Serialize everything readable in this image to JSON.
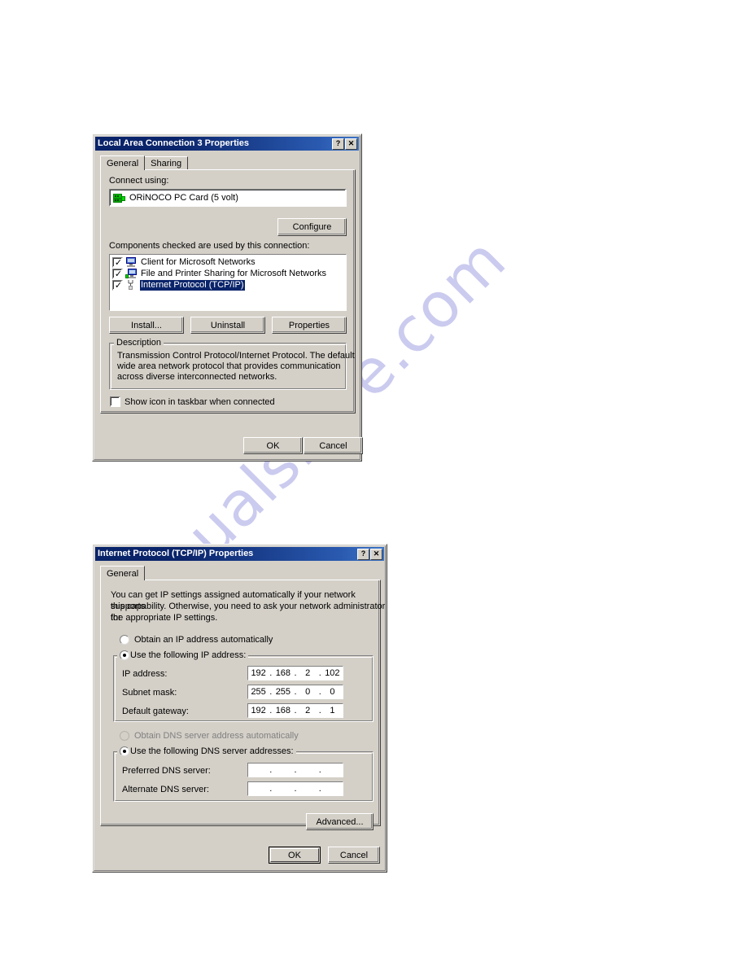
{
  "page": {
    "background": "#ffffff",
    "watermark_text": "manualshive.com",
    "watermark_color": "#c9c9ef"
  },
  "theme": {
    "dialog_face": "#d4d0c8",
    "titlebar_start": "#0a246a",
    "titlebar_end": "#3b74c6",
    "selection_blue": "#0a246a",
    "disabled_text": "#808080"
  },
  "dialog1": {
    "title": "Local Area Connection 3 Properties",
    "titlebar_buttons": [
      {
        "name": "help-icon",
        "glyph": "?"
      },
      {
        "name": "close-icon",
        "glyph": "✕"
      }
    ],
    "tabs": [
      {
        "label": "General",
        "active": true
      },
      {
        "label": "Sharing",
        "active": false
      }
    ],
    "connect_using_label": "Connect using:",
    "adapter": {
      "name": "ORiNOCO PC Card (5 volt)",
      "icon": "network-card-icon"
    },
    "configure_button": "Configure",
    "components_label": "Components checked are used by this connection:",
    "components": [
      {
        "label": "Client for Microsoft Networks",
        "checked": true,
        "selected": false,
        "icon": "computer-icon"
      },
      {
        "label": "File and Printer Sharing for Microsoft Networks",
        "checked": true,
        "selected": false,
        "icon": "sharing-computer-icon"
      },
      {
        "label": "Internet Protocol (TCP/IP)",
        "checked": true,
        "selected": true,
        "icon": "protocol-icon"
      }
    ],
    "buttons": {
      "install": "Install...",
      "uninstall": "Uninstall",
      "properties": "Properties"
    },
    "description": {
      "group_title": "Description",
      "line1": "Transmission Control Protocol/Internet Protocol. The default",
      "line2": "wide area network protocol that provides communication",
      "line3": "across diverse interconnected networks."
    },
    "show_icon_checkbox": {
      "label": "Show icon in taskbar when connected",
      "checked": false
    },
    "ok_button": "OK",
    "cancel_button": "Cancel"
  },
  "dialog2": {
    "title": "Internet Protocol (TCP/IP) Properties",
    "titlebar_buttons": [
      {
        "name": "help-icon",
        "glyph": "?"
      },
      {
        "name": "close-icon",
        "glyph": "✕"
      }
    ],
    "tabs": [
      {
        "label": "General",
        "active": true
      }
    ],
    "intro": {
      "line1": "You can get IP settings assigned automatically if your network supports",
      "line2": "this capability. Otherwise, you need to ask your network administrator for",
      "line3": "the appropriate IP settings."
    },
    "ip_mode": {
      "auto_label": "Obtain an IP address automatically",
      "auto_selected": false,
      "manual_label": "Use the following IP address:",
      "manual_selected": true
    },
    "ip_fields": [
      {
        "label": "IP address:",
        "octets": [
          "192",
          "168",
          "2",
          "102"
        ]
      },
      {
        "label": "Subnet mask:",
        "octets": [
          "255",
          "255",
          "0",
          "0"
        ]
      },
      {
        "label": "Default gateway:",
        "octets": [
          "192",
          "168",
          "2",
          "1"
        ]
      }
    ],
    "dns_mode": {
      "auto_label": "Obtain DNS server address automatically",
      "auto_selected": false,
      "auto_disabled": true,
      "manual_label": "Use the following DNS server addresses:",
      "manual_selected": true
    },
    "dns_fields": [
      {
        "label": "Preferred DNS server:",
        "octets": [
          "",
          "",
          "",
          ""
        ]
      },
      {
        "label": "Alternate DNS server:",
        "octets": [
          "",
          "",
          "",
          ""
        ]
      }
    ],
    "advanced_button": "Advanced...",
    "ok_button": "OK",
    "cancel_button": "Cancel"
  }
}
